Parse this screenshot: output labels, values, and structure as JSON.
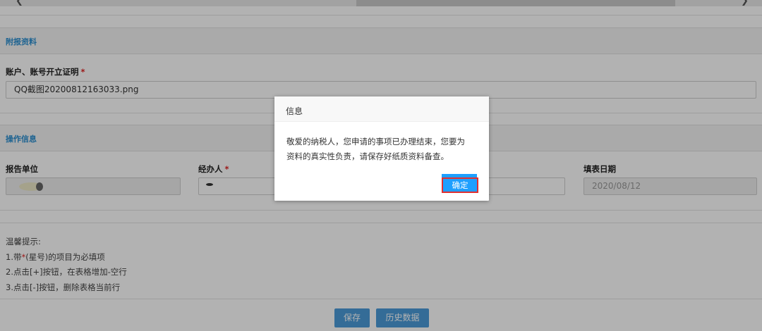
{
  "scrollbar": {
    "left_arrow": "❮",
    "right_arrow": "❯"
  },
  "attachments": {
    "section_title": "附报资料",
    "field_label": "账户、账号开立证明",
    "required_mark": "*",
    "file_value": "QQ截图20200812163033.png"
  },
  "operation": {
    "section_title": "操作信息",
    "report_unit": {
      "label": "报告单位",
      "value": ""
    },
    "handler": {
      "label": "经办人",
      "required_mark": "*",
      "value": ""
    },
    "fill_date": {
      "label": "填表日期",
      "value": "2020/08/12"
    }
  },
  "tips": {
    "title": "温馨提示:",
    "line1_prefix": "1.带",
    "line1_star": "*",
    "line1_suffix": "(星号)的项目为必填项",
    "line2": "2.点击[+]按钮，在表格增加-空行",
    "line3": "3.点击[-]按钮，删除表格当前行"
  },
  "buttons": {
    "save": "保存",
    "history": "历史数据"
  },
  "dialog": {
    "title": "信息",
    "message_line1": "敬爱的纳税人，您申请的事项已办理结束，您要为",
    "message_line2": "资料的真实性负责，请保存好纸质资料备查。",
    "confirm": "确定"
  },
  "colors": {
    "accent": "#2b8fd0",
    "required": "#e02424",
    "button": "#4b9bd8",
    "dialog_button": "#1e9fff",
    "highlight": "#e03030"
  }
}
